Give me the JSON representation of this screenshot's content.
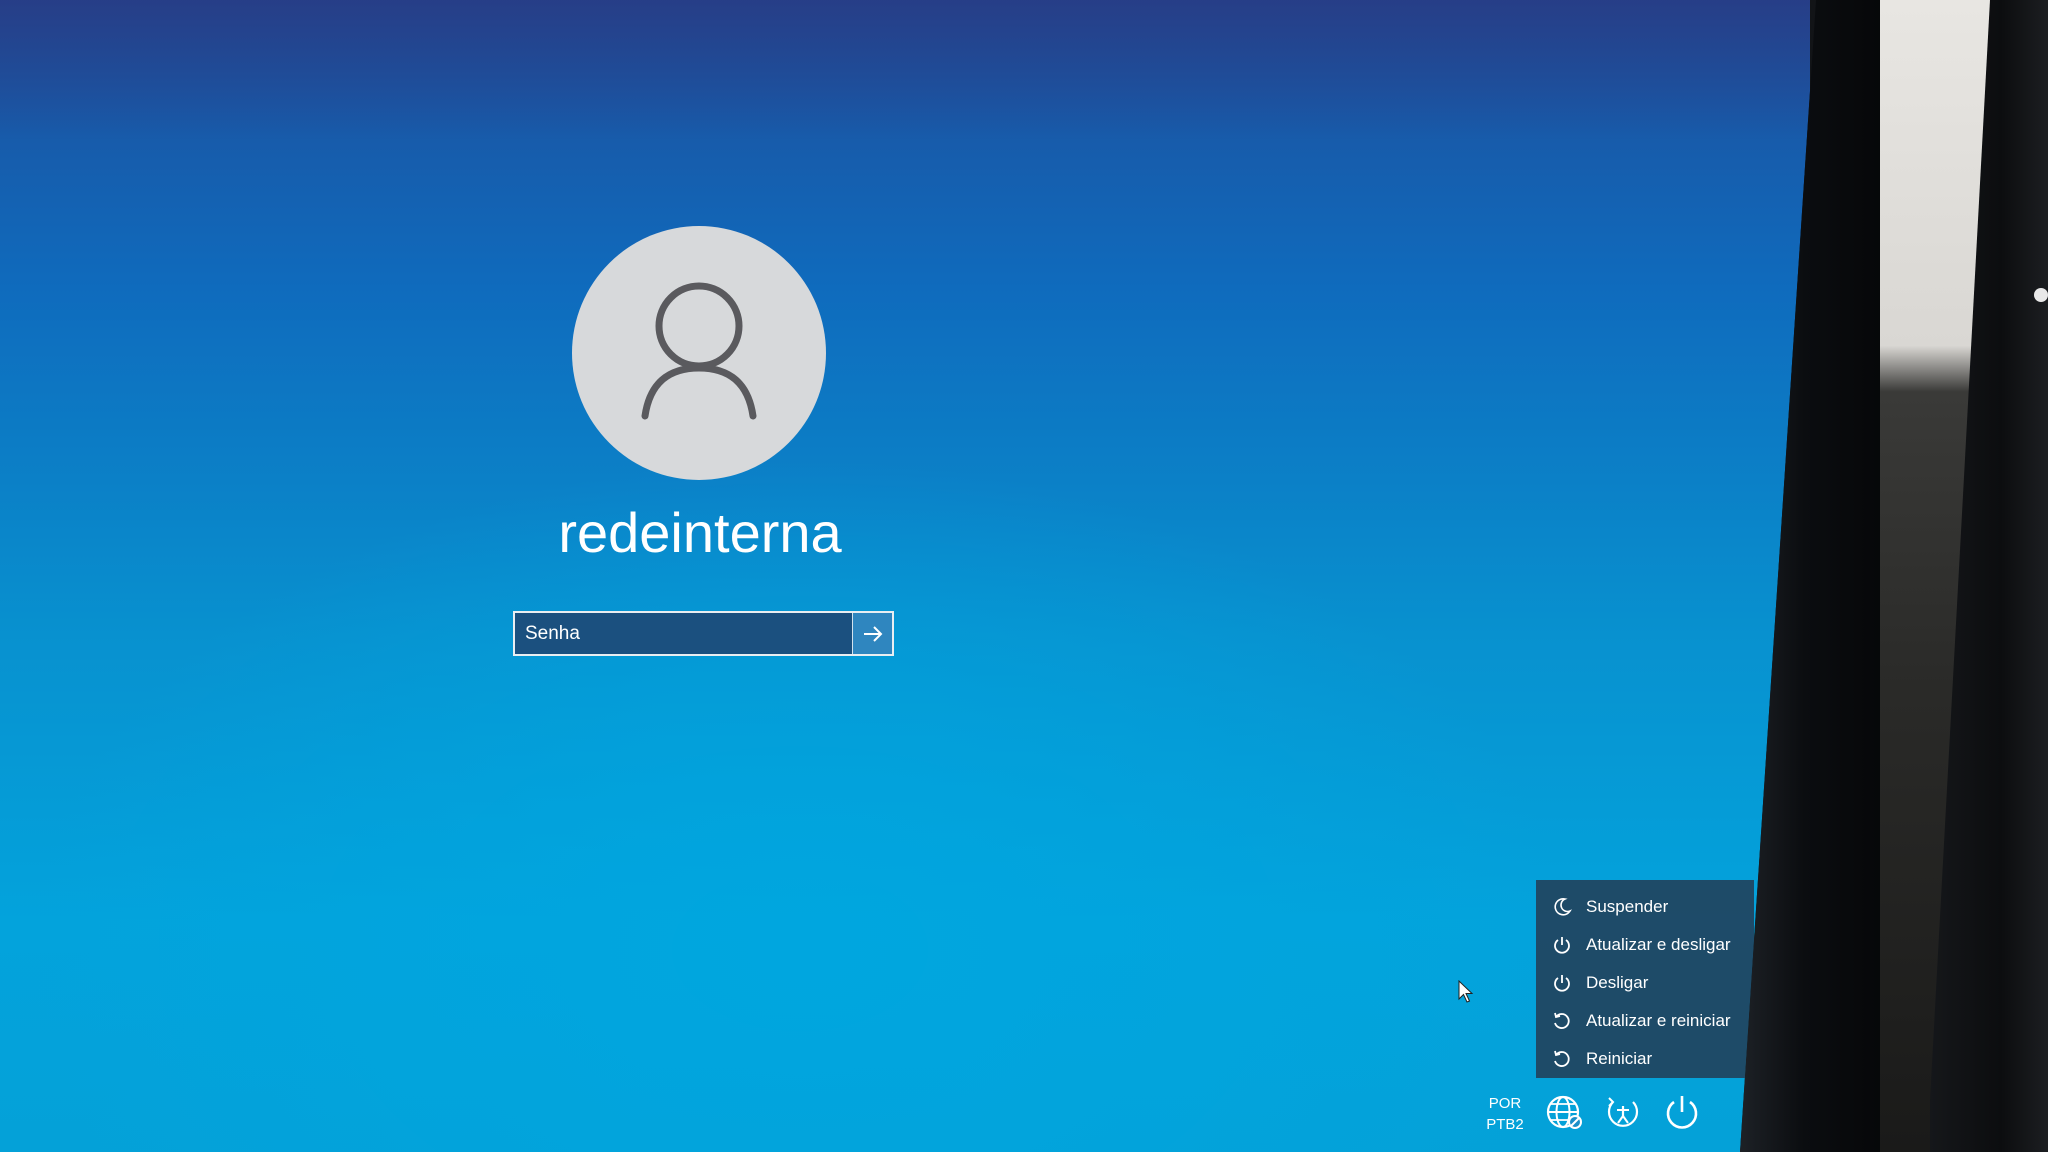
{
  "user": {
    "name": "redeinterna"
  },
  "login": {
    "password_placeholder": "Senha",
    "submit_glyph": "→"
  },
  "power_menu": {
    "items": [
      {
        "label": "Suspender",
        "icon": "moon-icon"
      },
      {
        "label": "Atualizar e desligar",
        "icon": "power-icon"
      },
      {
        "label": "Desligar",
        "icon": "power-icon"
      },
      {
        "label": "Atualizar e reiniciar",
        "icon": "restart-icon"
      },
      {
        "label": "Reiniciar",
        "icon": "restart-icon"
      }
    ]
  },
  "system_bar": {
    "language_line1": "POR",
    "language_line2": "PTB2",
    "network_icon": "globe-network-icon",
    "accessibility_icon": "ease-of-access-icon",
    "power_icon": "power-icon"
  },
  "colors": {
    "screen_top": "#1f4d9a",
    "screen_bottom": "#03a3dc",
    "menu_bg": "#21435e",
    "avatar_bg": "#d7d9db"
  }
}
